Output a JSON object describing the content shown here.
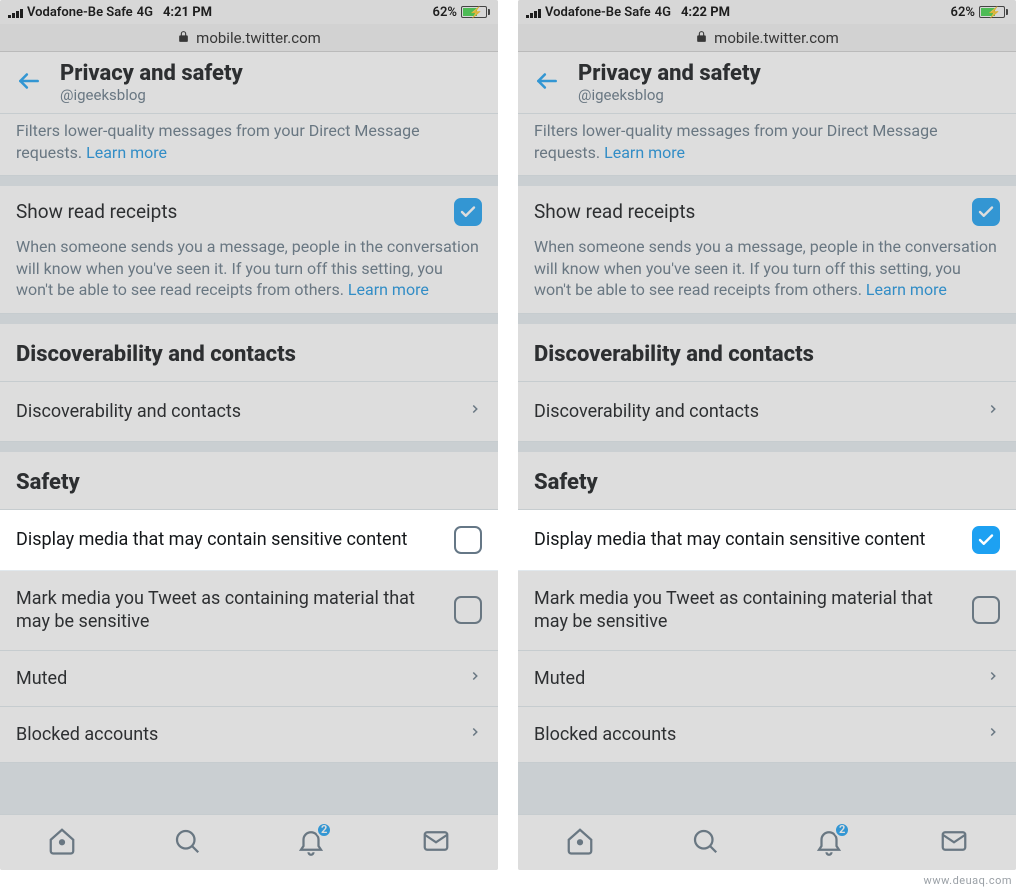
{
  "status": {
    "carrier": "Vodafone-Be Safe",
    "network": "4G",
    "battery_pct": "62%"
  },
  "url": "mobile.twitter.com",
  "header": {
    "title": "Privacy and safety",
    "subtitle": "@igeeksblog"
  },
  "filter": {
    "desc_prefix": "Filters lower-quality messages from your Direct Message requests. ",
    "learn_more": "Learn more"
  },
  "read_receipts": {
    "title": "Show read receipts",
    "desc": "When someone sends you a message, people in the conversation will know when you've seen it. If you turn off this setting, you won't be able to see read receipts from others. ",
    "learn_more": "Learn more"
  },
  "sections": {
    "discoverability_header": "Discoverability and contacts",
    "discoverability_row": "Discoverability and contacts",
    "safety_header": "Safety",
    "display_sensitive": "Display media that may contain sensitive content",
    "mark_sensitive": "Mark media you Tweet as containing material that may be sensitive",
    "muted": "Muted",
    "blocked": "Blocked accounts"
  },
  "nav_badge": "2",
  "left": {
    "time": "4:21 PM",
    "display_sensitive_checked": false
  },
  "right": {
    "time": "4:22 PM",
    "display_sensitive_checked": true
  },
  "watermark": "www.deuaq.com"
}
